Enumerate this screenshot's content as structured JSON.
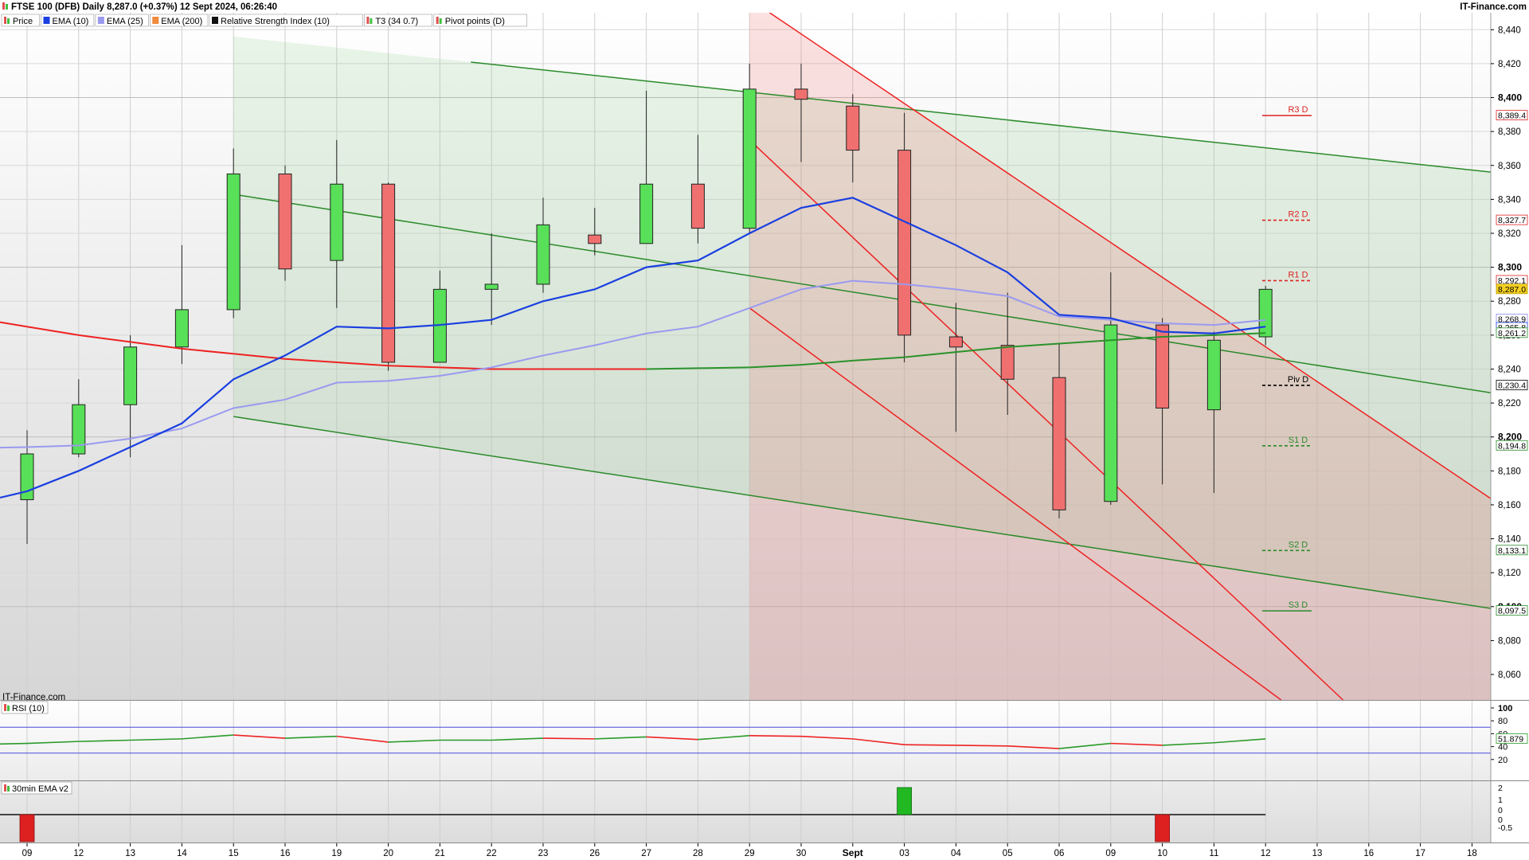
{
  "header": {
    "title": "FTSE 100 (DFB) Daily 8,287.0 (+0.37%) 12 Sept 2024, 06:26:40",
    "brand": "IT-Finance.com"
  },
  "legend": [
    {
      "label": "Price",
      "icon": "candle-icon",
      "color": "#3cb44b"
    },
    {
      "label": "EMA (10)",
      "icon": "color-swatch",
      "color": "#1a3fe0"
    },
    {
      "label": "EMA (25)",
      "icon": "color-swatch",
      "color": "#9a9af0"
    },
    {
      "label": "EMA (200)",
      "icon": "color-swatch",
      "color": "#f08a3c"
    },
    {
      "label": "Relative Strength Index (10)",
      "icon": "color-swatch",
      "color": "#111111"
    },
    {
      "label": "T3 (34 0.7)",
      "icon": "candle-icon",
      "color": "#3cb44b"
    },
    {
      "label": "Pivot points (D)",
      "icon": "candle-icon",
      "color": "#3cb44b"
    }
  ],
  "watermark": "IT-Finance.com",
  "colors": {
    "up": "#58e058",
    "down": "#f07070",
    "ema10": "#1a3fe0",
    "ema25": "#9a9af0",
    "t3_red": "#ee2222",
    "t3_green": "#2a922a",
    "channel_green": "#2a8a2a",
    "channel_red": "#ee2222"
  },
  "chart_data": [
    {
      "type": "candlestick",
      "title": "FTSE 100 (DFB) Daily",
      "x_tick_labels": [
        "09",
        "12",
        "13",
        "14",
        "15",
        "16",
        "19",
        "20",
        "21",
        "22",
        "23",
        "26",
        "27",
        "28",
        "29",
        "30",
        "Sept",
        "03",
        "04",
        "05",
        "06",
        "09",
        "10",
        "11",
        "12",
        "13",
        "16",
        "17",
        "18"
      ],
      "ylim": [
        8045,
        8450
      ],
      "y_ticks": [
        8060,
        8080,
        8100,
        8120,
        8140,
        8160,
        8180,
        8200,
        8220,
        8240,
        8260,
        8280,
        8300,
        8320,
        8340,
        8360,
        8380,
        8400,
        8420,
        8440
      ],
      "y_tick_labels": [
        "8,060",
        "8,080",
        "8,100",
        "8,120",
        "8,140",
        "8,160",
        "8,180",
        "8,200",
        "8,220",
        "8,240",
        "8,260",
        "8,280",
        "8,300",
        "8,320",
        "8,340",
        "8,360",
        "8,380",
        "8,400",
        "8,420",
        "8,440"
      ],
      "candles": [
        {
          "o": 8163,
          "h": 8204,
          "l": 8137,
          "c": 8190
        },
        {
          "o": 8190,
          "h": 8234,
          "l": 8188,
          "c": 8219
        },
        {
          "o": 8219,
          "h": 8260,
          "l": 8188,
          "c": 8253
        },
        {
          "o": 8253,
          "h": 8313,
          "l": 8243,
          "c": 8275
        },
        {
          "o": 8275,
          "h": 8370,
          "l": 8270,
          "c": 8355
        },
        {
          "o": 8355,
          "h": 8360,
          "l": 8292,
          "c": 8299
        },
        {
          "o": 8304,
          "h": 8375,
          "l": 8276,
          "c": 8349
        },
        {
          "o": 8349,
          "h": 8350,
          "l": 8239,
          "c": 8244
        },
        {
          "o": 8244,
          "h": 8298,
          "l": 8244,
          "c": 8287
        },
        {
          "o": 8287,
          "h": 8320,
          "l": 8266,
          "c": 8290
        },
        {
          "o": 8290,
          "h": 8341,
          "l": 8285,
          "c": 8325
        },
        {
          "o": 8319,
          "h": 8335,
          "l": 8307,
          "c": 8314
        },
        {
          "o": 8314,
          "h": 8404,
          "l": 8314,
          "c": 8349
        },
        {
          "o": 8349,
          "h": 8378,
          "l": 8314,
          "c": 8323
        },
        {
          "o": 8323,
          "h": 8420,
          "l": 8320,
          "c": 8405
        },
        {
          "o": 8405,
          "h": 8420,
          "l": 8362,
          "c": 8399
        },
        {
          "o": 8395,
          "h": 8402,
          "l": 8350,
          "c": 8369
        },
        {
          "o": 8369,
          "h": 8391,
          "l": 8244,
          "c": 8260
        },
        {
          "o": 8259,
          "h": 8279,
          "l": 8203,
          "c": 8253
        },
        {
          "o": 8254,
          "h": 8285,
          "l": 8213,
          "c": 8234
        },
        {
          "o": 8235,
          "h": 8255,
          "l": 8152,
          "c": 8157
        },
        {
          "o": 8162,
          "h": 8297,
          "l": 8160,
          "c": 8266
        },
        {
          "o": 8266,
          "h": 8270,
          "l": 8172,
          "c": 8217
        },
        {
          "o": 8216,
          "h": 8262,
          "l": 8167,
          "c": 8257
        },
        {
          "o": 8259,
          "h": 8289,
          "l": 8254,
          "c": 8287
        }
      ],
      "ema_10": [
        8168,
        8180,
        8194,
        8208,
        8234,
        8248,
        8265,
        8264,
        8266,
        8269,
        8280,
        8287,
        8300,
        8304,
        8320,
        8335,
        8341,
        8327,
        8313,
        8297,
        8272,
        8270,
        8262,
        8261,
        8265
      ],
      "ema_25": [
        8194,
        8195,
        8199,
        8205,
        8217,
        8222,
        8232,
        8233,
        8236,
        8241,
        8248,
        8254,
        8261,
        8265,
        8276,
        8287,
        8292,
        8290,
        8287,
        8283,
        8271,
        8269,
        8267,
        8266,
        8268.9
      ],
      "t3_34_0_7": [
        8265,
        8260,
        8256,
        8252,
        8249,
        8246,
        8244,
        8242,
        8241,
        8240,
        8240,
        8240,
        8240,
        8240.5,
        8241,
        8242.5,
        8245,
        8247,
        8250,
        8253,
        8255,
        8257,
        8259,
        8260,
        8261.2
      ],
      "pivot_points_d": [
        {
          "label": "R3 D",
          "value": 8389.4
        },
        {
          "label": "R2 D",
          "value": 8327.7
        },
        {
          "label": "R1 D",
          "value": 8292.1
        },
        {
          "label": "Piv D",
          "value": 8230.4
        },
        {
          "label": "S1 D",
          "value": 8194.8
        },
        {
          "label": "S2 D",
          "value": 8133.1
        },
        {
          "label": "S3 D",
          "value": 8097.5
        }
      ],
      "price_tags": [
        {
          "text": "8,389.4",
          "value": 8389.4
        },
        {
          "text": "8,327.7",
          "value": 8327.7
        },
        {
          "text": "8,292.1",
          "value": 8292.1
        },
        {
          "text": "8,287.0",
          "value": 8287.0
        },
        {
          "text": "8,268.9",
          "value": 8268.9
        },
        {
          "text": "8,265.8",
          "value": 8265.8
        },
        {
          "text": "8,261.2",
          "value": 8261.2
        },
        {
          "text": "8,230.4",
          "value": 8230.4
        },
        {
          "text": "8,194.8",
          "value": 8194.8
        },
        {
          "text": "8,133.1",
          "value": 8133.1
        },
        {
          "text": "8,097.5",
          "value": 8097.5
        }
      ],
      "green_channel": {
        "start_index": 4,
        "upper": [
          [
            4,
            8436
          ],
          [
            29,
            8354
          ]
        ],
        "mid": [
          [
            4,
            8343
          ],
          [
            29,
            8223
          ]
        ],
        "lower": [
          [
            4,
            8212
          ],
          [
            29,
            8096
          ]
        ]
      },
      "red_channel": {
        "start_index": 14,
        "top_line": [
          [
            14,
            8458
          ],
          [
            28.3,
            8165
          ]
        ],
        "mid_line": [
          [
            14,
            8375
          ],
          [
            25.5,
            8045
          ]
        ],
        "bottom_line": [
          [
            14,
            8276
          ],
          [
            24.3,
            8045
          ]
        ]
      }
    },
    {
      "type": "line",
      "title": "RSI (10)",
      "ylim": [
        0,
        100
      ],
      "y_tick_labels": [
        "100",
        "80",
        "60",
        "40",
        "20"
      ],
      "levels": [
        70,
        30
      ],
      "values": [
        45,
        48,
        50,
        52,
        58,
        53,
        56,
        47,
        50,
        50,
        53,
        52,
        55,
        51,
        57,
        56,
        52,
        43,
        42,
        41,
        37,
        45,
        42,
        46,
        51.879
      ],
      "last_value_text": "51.879"
    },
    {
      "type": "bar",
      "title": "30min EMA v2",
      "y_tick_labels": [
        "2",
        "1",
        "0",
        "0",
        "-0.5"
      ],
      "values": [
        -1,
        0,
        0,
        0,
        0,
        0,
        0,
        0,
        0,
        0,
        0,
        0,
        0,
        0,
        0,
        0,
        0,
        1,
        0,
        0,
        0,
        0,
        -1,
        0,
        0
      ]
    }
  ]
}
